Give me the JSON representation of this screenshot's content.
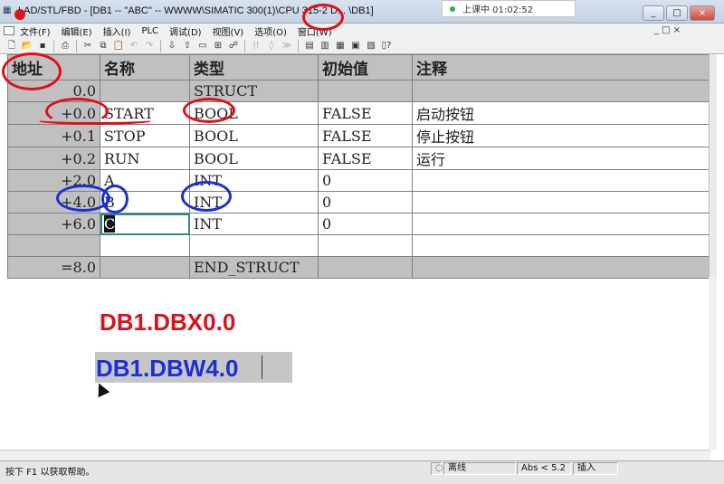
{
  "window": {
    "title": "LAD/STL/FBD - [DB1 -- \"ABC\" -- WWWW\\SIMATIC 300(1)\\CPU 315-2 D... \\DB1]",
    "class_overlay": "上课中 01:02:52",
    "buttons": [
      "_",
      "□",
      "×"
    ]
  },
  "menu": {
    "items": [
      "文件(F)",
      "编辑(E)",
      "插入(I)",
      "PLC",
      "调试(D)",
      "视图(V)",
      "选项(O)",
      "窗口(W)"
    ],
    "mdi_controls": "_ □ ×"
  },
  "toolbar": {
    "icons": [
      "new-icon",
      "open-icon",
      "save-icon",
      "print-icon",
      "cut-icon",
      "copy-icon",
      "paste-icon",
      "undo-icon",
      "redo-icon",
      "download-icon",
      "upload-icon",
      "monitor-icon",
      "network-icon",
      "overview-icon",
      "breakpoint-icon",
      "layout-icon",
      "help-icon"
    ]
  },
  "table": {
    "headers": [
      "地址",
      "名称",
      "类型",
      "初始值",
      "注释"
    ],
    "rows": [
      {
        "addr": "0.0",
        "name": "",
        "type": "STRUCT",
        "init": "",
        "comment": "",
        "kind": "struct"
      },
      {
        "addr": "+0.0",
        "name": "START",
        "type": "BOOL",
        "init": "FALSE",
        "comment": "启动按钮",
        "kind": "row"
      },
      {
        "addr": "+0.1",
        "name": "STOP",
        "type": "BOOL",
        "init": "FALSE",
        "comment": "停止按钮",
        "kind": "row"
      },
      {
        "addr": "+0.2",
        "name": "RUN",
        "type": "BOOL",
        "init": "FALSE",
        "comment": "运行",
        "kind": "row"
      },
      {
        "addr": "+2.0",
        "name": "A",
        "type": "INT",
        "init": "0",
        "comment": "",
        "kind": "row"
      },
      {
        "addr": "+4.0",
        "name": "B",
        "type": "INT",
        "init": "0",
        "comment": "",
        "kind": "row"
      },
      {
        "addr": "+6.0",
        "name": "C",
        "type": "INT",
        "init": "0",
        "comment": "",
        "kind": "row"
      },
      {
        "addr": "",
        "name": "",
        "type": "",
        "init": "",
        "comment": "",
        "kind": "empty"
      },
      {
        "addr": "=8.0",
        "name": "",
        "type": "END_STRUCT",
        "init": "",
        "comment": "",
        "kind": "struct"
      }
    ]
  },
  "notes": {
    "red_text": "DB1.DBX0.0",
    "blue_text": "DB1.DBW4.0",
    "red_color": "#d4141b",
    "blue_color": "#1a2fd6"
  },
  "status": {
    "help": "按下 F1 以获取帮助。",
    "mode": "离线",
    "abs": "Abs < 5.2",
    "insert": "插入"
  }
}
